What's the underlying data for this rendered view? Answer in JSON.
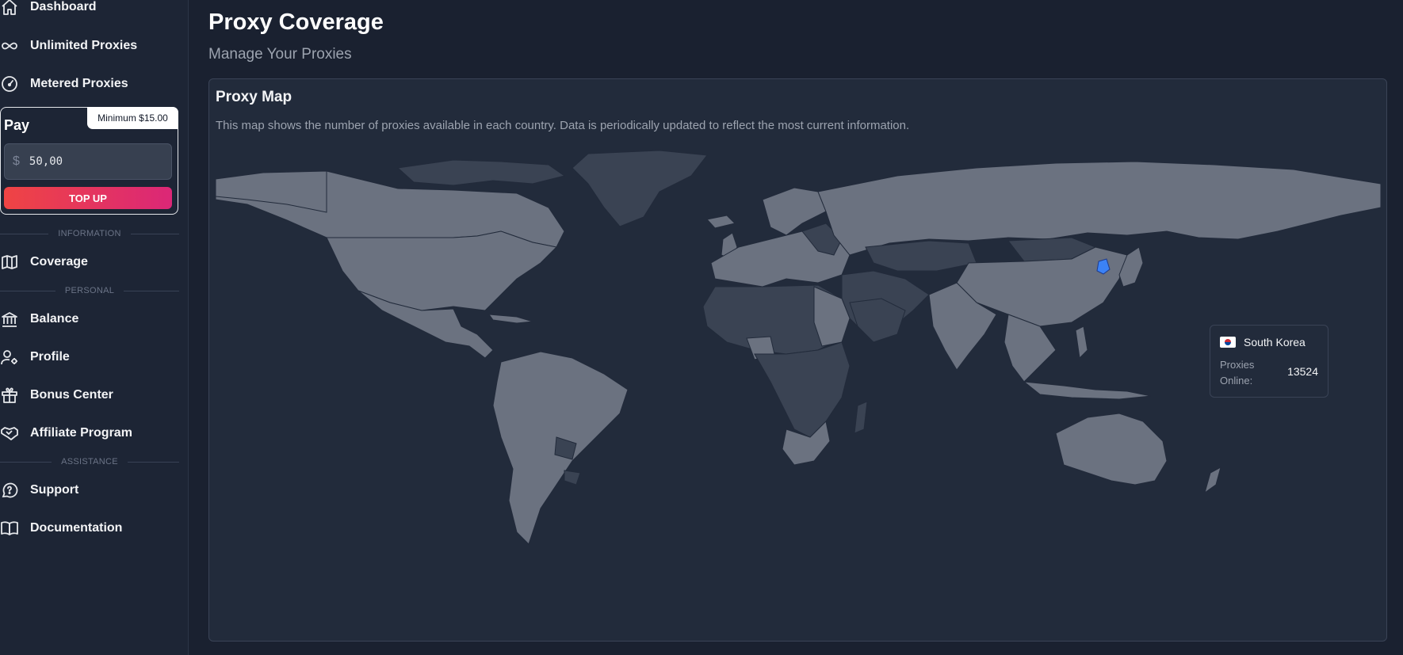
{
  "sidebar": {
    "nav_top": [
      {
        "label": "Dashboard",
        "icon": "home-icon"
      },
      {
        "label": "Unlimited Proxies",
        "icon": "infinity-icon"
      },
      {
        "label": "Metered Proxies",
        "icon": "gauge-icon"
      }
    ],
    "pay": {
      "title": "Pay",
      "minimum_badge": "Minimum $15.00",
      "currency_symbol": "$",
      "amount": "50,00",
      "topup_label": "TOP UP"
    },
    "sections": {
      "information": "INFORMATION",
      "personal": "PERSONAL",
      "assistance": "ASSISTANCE"
    },
    "coverage_label": "Coverage",
    "personal_items": [
      {
        "label": "Balance",
        "icon": "bank-icon"
      },
      {
        "label": "Profile",
        "icon": "user-gear-icon"
      },
      {
        "label": "Bonus Center",
        "icon": "gift-icon"
      },
      {
        "label": "Affiliate Program",
        "icon": "handshake-icon"
      }
    ],
    "assistance_items": [
      {
        "label": "Support",
        "icon": "help-bubble-icon"
      },
      {
        "label": "Documentation",
        "icon": "book-icon"
      }
    ]
  },
  "main": {
    "title": "Proxy Coverage",
    "subtitle": "Manage Your Proxies",
    "map_card": {
      "title": "Proxy Map",
      "description": "This map shows the number of proxies available in each country. Data is periodically updated to reflect the most current information."
    },
    "tooltip": {
      "country": "South Korea",
      "flag_icon": "south-korea-flag-icon",
      "label": "Proxies Online:",
      "value": "13524"
    }
  },
  "colors": {
    "background": "#1a2130",
    "sidebar": "#1d2535",
    "card": "#222b3b",
    "land_high": "#6b7280",
    "land_low": "#3a4353",
    "highlight": "#3b82f6",
    "topup_gradient_start": "#ef4444",
    "topup_gradient_end": "#db2777"
  }
}
